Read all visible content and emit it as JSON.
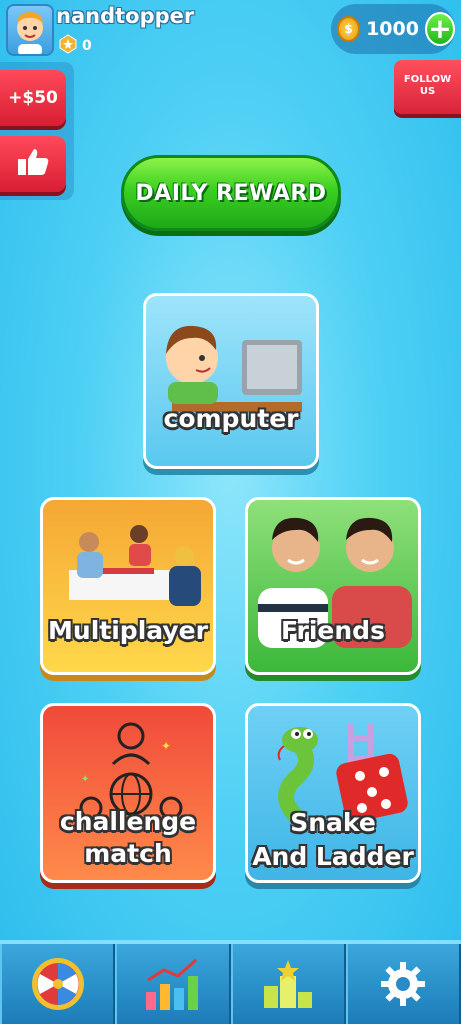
{
  "profile": {
    "username": "nandtopper",
    "level": "0"
  },
  "left_panel": {
    "bonus_label": "+$50",
    "like_icon": "thumbs-up-icon"
  },
  "wallet": {
    "coins": "1000",
    "plus_icon": "plus-icon",
    "coin_icon": "coin-icon"
  },
  "follow": {
    "line1": "FOLLOW",
    "line2": "US"
  },
  "daily_reward": {
    "label": "DAILY REWARD"
  },
  "modes": {
    "computer": "computer",
    "multiplayer": "Multiplayer",
    "friends": "Friends",
    "challenge_line1": "challenge",
    "challenge_line2": "match",
    "snake_line1": "Snake",
    "snake_line2": "And Ladder"
  },
  "bottom_nav": [
    "spin-wheel-icon",
    "stats-chart-icon",
    "leaderboard-icon",
    "settings-gear-icon"
  ],
  "colors": {
    "accent_green": "#3bd020",
    "accent_red": "#d91e33",
    "background": "#4fd0f5"
  }
}
